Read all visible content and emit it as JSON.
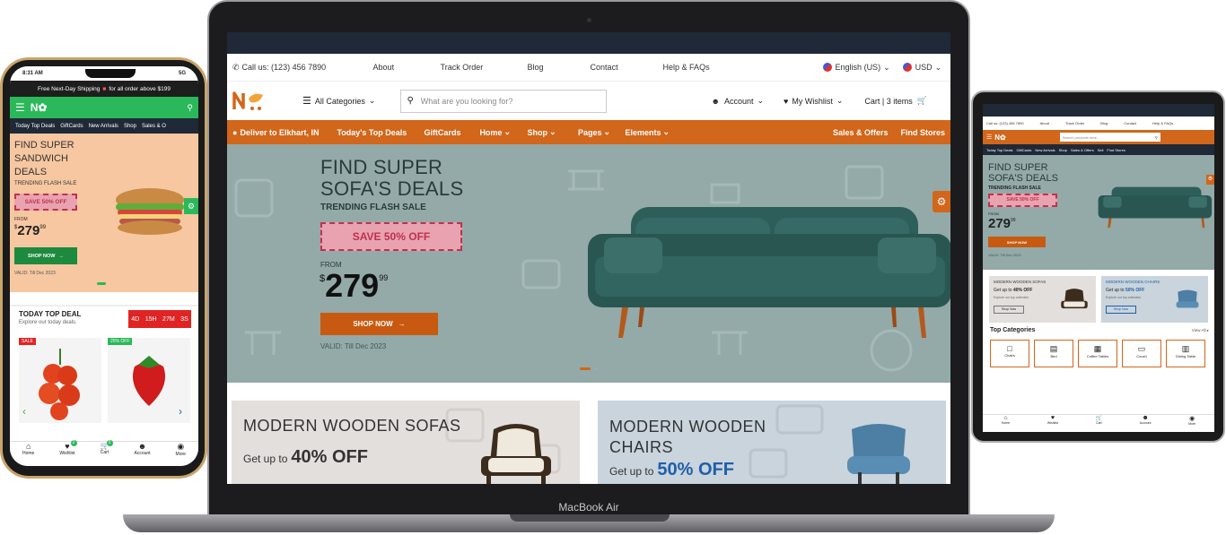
{
  "laptop": {
    "device_label": "MacBook Air",
    "topbar": {
      "phone": "Call us: (123) 456 7890",
      "links": [
        "About",
        "Track Order",
        "Blog",
        "Contact",
        "Help & FAQs"
      ],
      "language": "English (US)",
      "currency": "USD"
    },
    "header": {
      "categories_label": "All Categories",
      "search_placeholder": "What are you looking for?",
      "account_label": "Account",
      "wishlist_label": "My Wishlist",
      "cart_label": "Cart | 3 items"
    },
    "nav": {
      "deliver": "Deliver to Elkhart, IN",
      "items": [
        "Today's Top Deals",
        "GiftCards",
        "Home",
        "Shop",
        "Pages",
        "Elements"
      ],
      "right_items": [
        "Sales & Offers",
        "Find Stores"
      ]
    },
    "hero": {
      "title_line1": "FIND SUPER",
      "title_line2": "SOFA'S DEALS",
      "subtitle": "TRENDING FLASH SALE",
      "badge": "SAVE 50% OFF",
      "from_label": "FROM",
      "currency_symbol": "$",
      "price_main": "279",
      "price_cents": "99",
      "cta": "SHOP NOW",
      "valid": "VALID: Till Dec 2023"
    },
    "cards": [
      {
        "title": "MODERN WOODEN SOFAS",
        "prefix": "Get up to",
        "discount": "40% OFF"
      },
      {
        "title_line1": "MODERN WOODEN",
        "title_line2": "CHAIRS",
        "prefix": "Get up to",
        "discount": "50% OFF"
      }
    ]
  },
  "phone": {
    "status_time": "8:31 AM",
    "status_right": "5G",
    "shipping_banner": "Free Next-Day Shipping",
    "shipping_suffix": "for all order above $199",
    "nav_items": [
      "Today Top Deals",
      "GiftCards",
      "New Arrivals",
      "Shop",
      "Sales & O"
    ],
    "hero": {
      "title_line1": "FIND SUPER",
      "title_line2": "SANDWICH",
      "title_line3": "DEALS",
      "subtitle": "TRENDING FLASH SALE",
      "badge": "SAVE 50% OFF",
      "from_label": "FROM",
      "currency_symbol": "$",
      "price_main": "279",
      "price_cents": "99",
      "cta": "SHOP NOW",
      "valid": "VALID: Till Dec 2023"
    },
    "deal": {
      "title": "TODAY TOP DEAL",
      "subtitle": "Explore our today deals.",
      "timer": [
        "4D",
        "15H",
        "27M",
        "3S"
      ],
      "tags": [
        "SALE",
        "25% OFF"
      ]
    },
    "bottom_nav": [
      "Home",
      "Wishlist",
      "Cart",
      "Account",
      "More"
    ],
    "wishlist_count": "2",
    "cart_count": "3"
  },
  "tablet": {
    "hero": {
      "title_line1": "FIND SUPER",
      "title_line2": "SOFA'S DEALS",
      "subtitle": "TRENDING FLASH SALE",
      "badge": "SAVE 50% OFF",
      "from_label": "FROM",
      "price_main": "279",
      "price_cents": "99",
      "cta": "SHOP NOW",
      "valid": "VALID: Till Dec 2023"
    },
    "search_placeholder": "Search products here...",
    "topbar_phone": "Call us: (123) 456 7890",
    "topbar_links": [
      "About",
      "Track Order",
      "Blog",
      "Contact",
      "Help & FAQs"
    ],
    "nav_items": [
      "Today Top Deals",
      "GiftCards",
      "New Arrivals",
      "Shop",
      "Sales & Offers",
      "Sell",
      "Find Stores"
    ],
    "cards": [
      {
        "title": "MODERN WOODEN SOFAS",
        "prefix": "Get up to",
        "discount": "40% OFF",
        "note": "Explore our top collection",
        "cta": "Shop Now"
      },
      {
        "title": "MODERN WOODEN CHAIRS",
        "prefix": "Get up to",
        "discount": "50% OFF",
        "note": "Explore our top collection",
        "cta": "Shop Now"
      }
    ],
    "categories_title": "Top Categories",
    "view_all": "View All",
    "categories": [
      "Chairs",
      "Bed",
      "Coffee Tables",
      "Couch",
      "Dining Table"
    ],
    "bottom_nav": [
      "Home",
      "Wishlist",
      "Cart",
      "Account",
      "More"
    ]
  },
  "colors": {
    "orange": "#d2661a",
    "green": "#2bb85a",
    "dark": "#1f2937",
    "hero_teal": "#93aaa8",
    "sofa": "#2e5e5a",
    "peach": "#f6c7a0"
  }
}
